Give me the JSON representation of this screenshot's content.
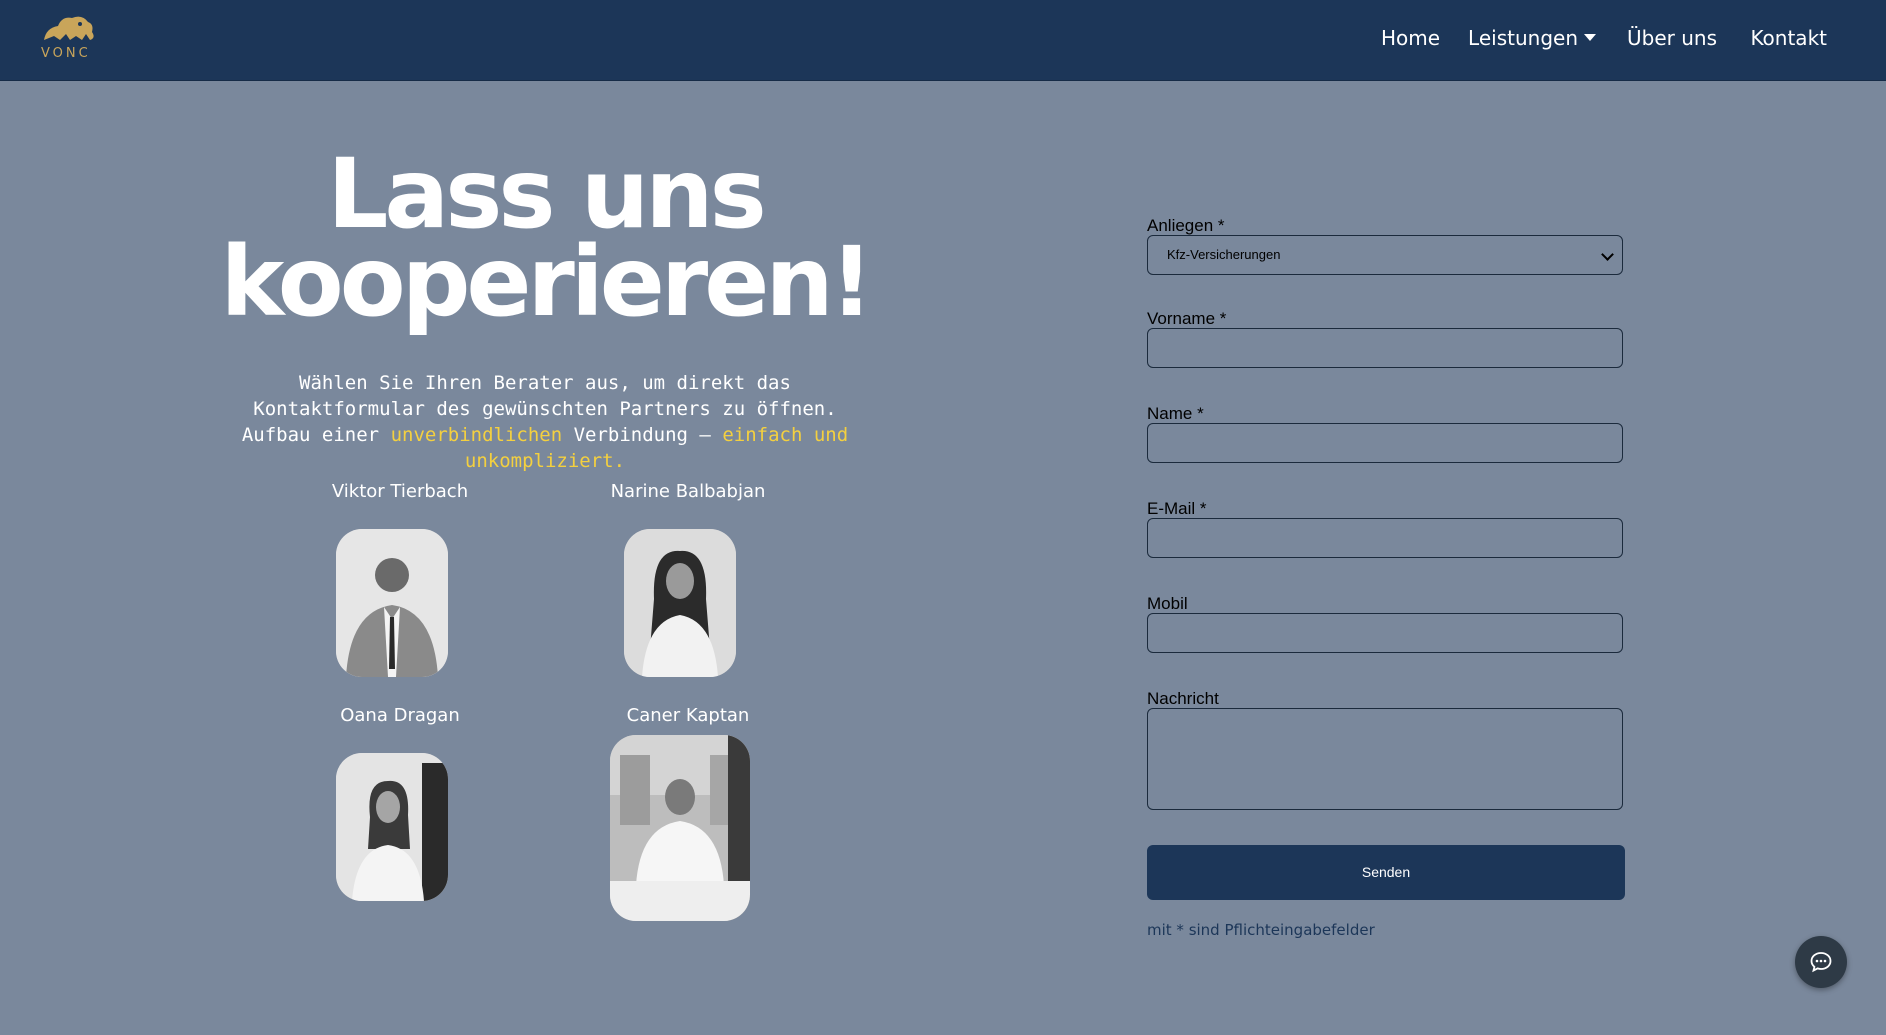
{
  "brand": {
    "logo_text": "VONC"
  },
  "nav": {
    "home": "Home",
    "leistungen": "Leistungen",
    "ueber_uns": "Über uns",
    "kontakt": "Kontakt"
  },
  "hero": {
    "headline_line1": "Lass uns",
    "headline_line2": "kooperieren!",
    "intro_part1": "Wählen Sie Ihren Berater aus, um direkt das Kontaktformular des gewünschten Partners zu öffnen. Aufbau einer ",
    "intro_highlight1": "unverbindlichen",
    "intro_part2": " Verbindung – ",
    "intro_highlight2": "einfach und unkompliziert",
    "intro_part3": "."
  },
  "advisors": [
    {
      "name": "Viktor Tierbach"
    },
    {
      "name": "Narine Balbabjan"
    },
    {
      "name": "Oana Dragan"
    },
    {
      "name": "Caner Kaptan"
    }
  ],
  "form": {
    "anliegen_label": "Anliegen *",
    "anliegen_value": "Kfz-Versicherungen",
    "vorname_label": "Vorname *",
    "name_label": "Name *",
    "email_label": "E-Mail *",
    "mobil_label": "Mobil",
    "nachricht_label": "Nachricht",
    "submit_label": "Senden",
    "required_note": "mit * sind Pflichteingabefelder"
  },
  "colors": {
    "header_bg": "#1c3658",
    "page_bg": "#7a889c",
    "highlight": "#f4d03f",
    "logo_gold": "#c9a55a"
  },
  "icons": {
    "logo": "lion-logo-icon",
    "dropdown": "caret-down-icon",
    "chat": "chat-bubble-icon"
  }
}
